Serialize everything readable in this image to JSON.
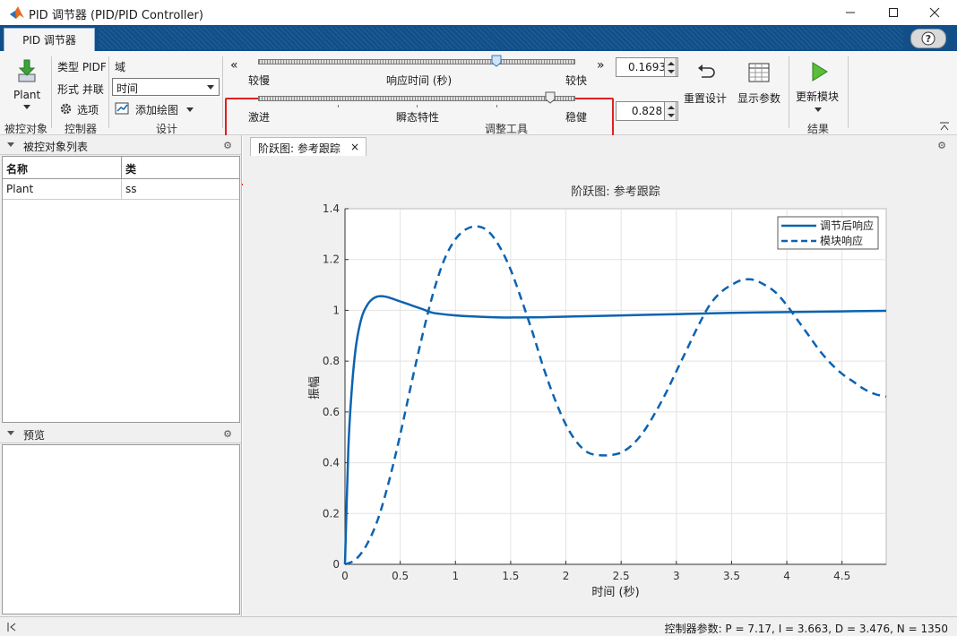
{
  "window": {
    "title": "PID 调节器 (PID/PID Controller)",
    "min_icon": "minimize-icon",
    "max_icon": "maximize-icon",
    "close_icon": "close-icon"
  },
  "ribbon": {
    "tab": "PID 调节器",
    "help_icon": "help-icon"
  },
  "toolstrip": {
    "plant_label": "Plant",
    "plant_section": "被控对象",
    "type_label": "类型 PIDF",
    "form_label": "形式 并联",
    "options_label": "选项",
    "controller_section": "控制器",
    "domain_label": "域",
    "domain_value": "时间",
    "add_plot_label": "添加绘图",
    "design_section": "设计",
    "response_time": {
      "left": "较慢",
      "center": "响应时间 (秒)",
      "right": "较快",
      "value": "0.1693",
      "slider_fraction": 0.75
    },
    "transient": {
      "left": "激进",
      "center": "瞬态特性",
      "right": "稳健",
      "value": "0.828",
      "slider_fraction": 0.92
    },
    "tuning_section": "调整工具",
    "reset_label": "重置设计",
    "show_params_label": "显示参数",
    "update_label": "更新模块",
    "result_section": "结果"
  },
  "left_panel": {
    "plants_title": "被控对象列表",
    "col_name": "名称",
    "col_type": "类",
    "rows": [
      {
        "name": "Plant",
        "type": "ss"
      }
    ],
    "preview_title": "预览"
  },
  "document": {
    "tab_label": "阶跃图: 参考跟踪"
  },
  "chart_data": {
    "type": "line",
    "title": "阶跃图: 参考跟踪",
    "xlabel": "时间 (秒)",
    "ylabel": "振幅",
    "xlim": [
      0,
      4.9
    ],
    "ylim": [
      0,
      1.4
    ],
    "xticks": [
      "0",
      "0.5",
      "1",
      "1.5",
      "2",
      "2.5",
      "3",
      "3.5",
      "4",
      "4.5"
    ],
    "yticks": [
      "0",
      "0.2",
      "0.4",
      "0.6",
      "0.8",
      "1",
      "1.2",
      "1.4"
    ],
    "grid": true,
    "legend_position": "top-right",
    "series": [
      {
        "name": "调节后响应",
        "style": "solid",
        "color": "#0b63b1",
        "x": [
          0,
          0.03,
          0.06,
          0.1,
          0.15,
          0.2,
          0.25,
          0.3,
          0.35,
          0.4,
          0.5,
          0.6,
          0.7,
          0.8,
          1.0,
          1.2,
          1.4,
          1.6,
          1.8,
          2.0,
          2.5,
          3.0,
          3.5,
          4.0,
          4.5,
          4.9
        ],
        "y": [
          0,
          0.45,
          0.68,
          0.86,
          0.97,
          1.02,
          1.045,
          1.055,
          1.055,
          1.05,
          1.035,
          1.02,
          1.005,
          0.99,
          0.98,
          0.975,
          0.972,
          0.972,
          0.973,
          0.975,
          0.98,
          0.985,
          0.99,
          0.993,
          0.996,
          0.998
        ]
      },
      {
        "name": "模块响应",
        "style": "dashed",
        "color": "#0b63b1",
        "x": [
          0,
          0.1,
          0.2,
          0.3,
          0.4,
          0.5,
          0.6,
          0.7,
          0.8,
          0.9,
          1.0,
          1.1,
          1.2,
          1.3,
          1.4,
          1.5,
          1.6,
          1.7,
          1.8,
          1.9,
          2.0,
          2.1,
          2.2,
          2.3,
          2.4,
          2.5,
          2.6,
          2.7,
          2.8,
          2.9,
          3.0,
          3.1,
          3.2,
          3.3,
          3.4,
          3.5,
          3.6,
          3.7,
          3.8,
          3.9,
          4.0,
          4.1,
          4.2,
          4.3,
          4.4,
          4.5,
          4.6,
          4.7,
          4.8,
          4.9
        ],
        "y": [
          0,
          0.02,
          0.08,
          0.18,
          0.33,
          0.51,
          0.71,
          0.9,
          1.07,
          1.2,
          1.28,
          1.32,
          1.33,
          1.31,
          1.25,
          1.16,
          1.04,
          0.91,
          0.77,
          0.65,
          0.55,
          0.48,
          0.44,
          0.43,
          0.43,
          0.44,
          0.47,
          0.52,
          0.59,
          0.67,
          0.76,
          0.85,
          0.94,
          1.02,
          1.07,
          1.1,
          1.12,
          1.12,
          1.1,
          1.07,
          1.02,
          0.96,
          0.9,
          0.84,
          0.79,
          0.75,
          0.72,
          0.69,
          0.67,
          0.66
        ]
      }
    ]
  },
  "status": {
    "params": "控制器参数: P = 7.17, I = 3.663, D = 3.476, N = 1350",
    "left_icon": "collapse-icon"
  }
}
